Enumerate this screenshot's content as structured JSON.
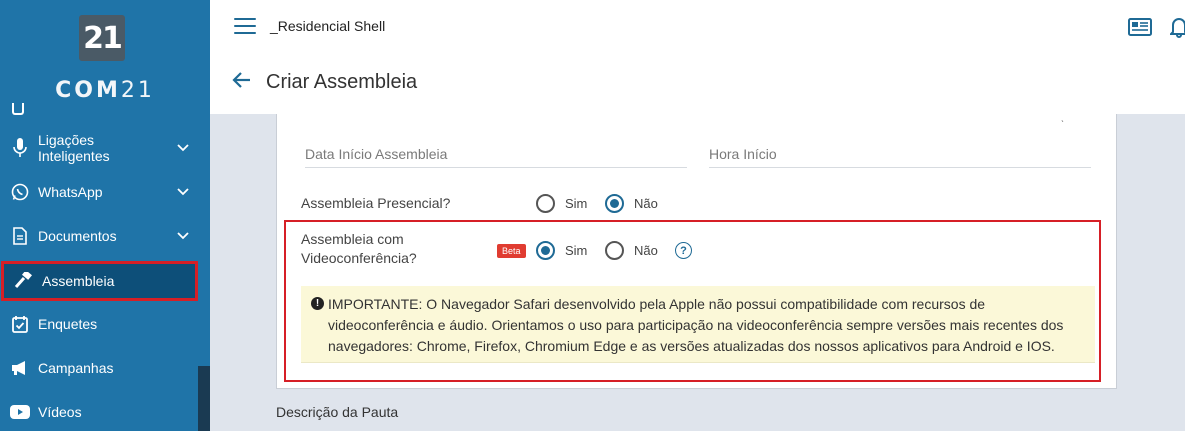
{
  "sidebar": {
    "logo_badge": "21",
    "logo_text_bold": "COM",
    "logo_text_light": "21",
    "items": [
      {
        "label": "Ligações Inteligentes",
        "icon": "microphone-icon",
        "has_chevron": true
      },
      {
        "label": "WhatsApp",
        "icon": "whatsapp-icon",
        "has_chevron": true
      },
      {
        "label": "Documentos",
        "icon": "document-icon",
        "has_chevron": true
      },
      {
        "label": "Assembleia",
        "icon": "gavel-icon",
        "active": true
      },
      {
        "label": "Enquetes",
        "icon": "calendar-check-icon"
      },
      {
        "label": "Campanhas",
        "icon": "megaphone-icon"
      },
      {
        "label": "Vídeos",
        "icon": "youtube-icon"
      }
    ]
  },
  "header": {
    "company": "_Residencial Shell",
    "page_title": "Criar Assembleia"
  },
  "form": {
    "date_placeholder": "Data Início Assembleia",
    "time_placeholder": "Hora Início",
    "presencial_label": "Assembleia Presencial?",
    "presencial_options": [
      {
        "label": "Sim",
        "checked": false
      },
      {
        "label": "Não",
        "checked": true
      }
    ],
    "video_label": "Assembleia com Videoconferência?",
    "beta_badge": "Beta",
    "video_options": [
      {
        "label": "Sim",
        "checked": true
      },
      {
        "label": "Não",
        "checked": false
      }
    ],
    "help_glyph": "?",
    "warning_glyph": "!",
    "warning_text": "IMPORTANTE: O Navegador Safari desenvolvido pela Apple não possui compatibilidade com recursos de videoconferência e áudio. Orientamos o uso para participação na videoconferência sempre versões mais recentes dos navegadores: Chrome, Firefox, Chromium Edge e as versões atualizadas dos nossos aplicativos para Android e IOS.",
    "description_label": "Descrição da Pauta"
  },
  "colors": {
    "sidebar_bg": "#1f74a8",
    "primary": "#1f6a95",
    "highlight_border": "#d61f26",
    "beta_bg": "#e03c31",
    "warning_bg": "#fbf8d8"
  }
}
